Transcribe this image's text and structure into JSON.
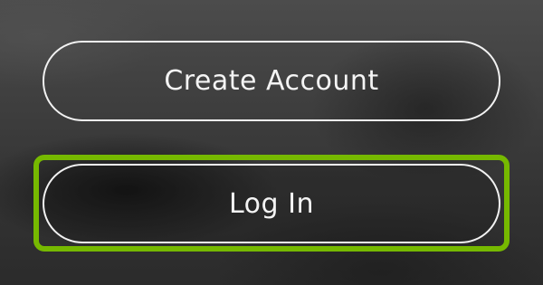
{
  "buttons": {
    "create_account_label": "Create Account",
    "log_in_label": "Log In"
  },
  "colors": {
    "focus_highlight": "#76b900",
    "button_border": "#f2f2f2",
    "text": "#f4f4f4"
  },
  "focused_button": "Log In"
}
